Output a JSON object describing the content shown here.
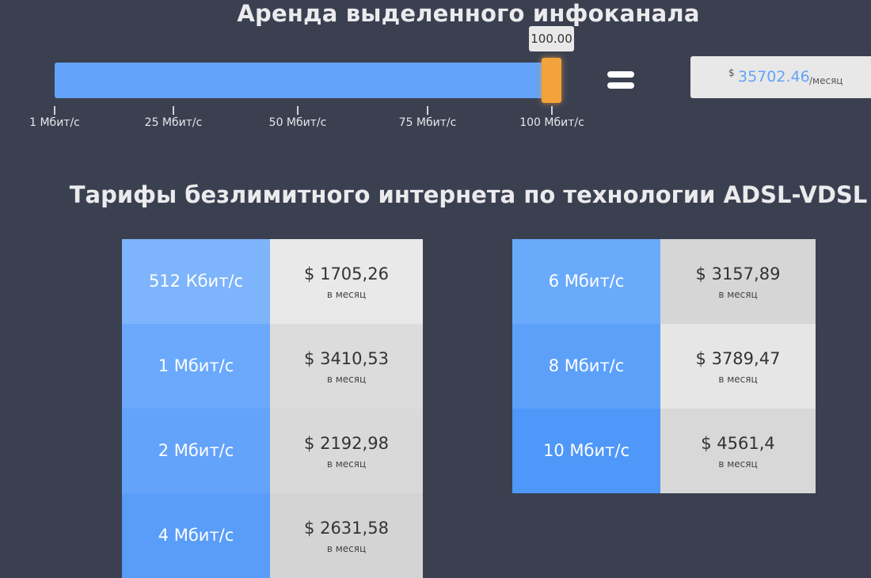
{
  "header": {
    "title": "Аренда выделенного инфоканала"
  },
  "slider": {
    "value_label": "100.00",
    "fill_fraction": 1.0,
    "ticks": [
      "1 Мбит/с",
      "25 Мбит/с",
      "50 Мбит/с",
      "75 Мбит/с",
      "100 Мбит/с"
    ],
    "colors": {
      "fill": "#63a3fa",
      "handle": "#f3a33b"
    }
  },
  "result": {
    "currency": "$",
    "value": "35702.46",
    "per": "/месяц"
  },
  "tariffs": {
    "title": "Тарифы безлимитного интернета по технологии ADSL-VDSL",
    "left": [
      {
        "speed": "512 Кбит/с",
        "price": "$ 1705,26",
        "per": "в месяц"
      },
      {
        "speed": "1 Мбит/с",
        "price": "$ 3410,53",
        "per": "в месяц"
      },
      {
        "speed": "2 Мбит/с",
        "price": "$ 2192,98",
        "per": "в месяц"
      },
      {
        "speed": "4 Мбит/с",
        "price": "$ 2631,58",
        "per": "в месяц"
      }
    ],
    "right": [
      {
        "speed": "6 Мбит/с",
        "price": "$ 3157,89",
        "per": "в месяц"
      },
      {
        "speed": "8 Мбит/с",
        "price": "$ 3789,47",
        "per": "в месяц"
      },
      {
        "speed": "10 Мбит/с",
        "price": "$ 4561,4",
        "per": "в месяц"
      }
    ]
  }
}
